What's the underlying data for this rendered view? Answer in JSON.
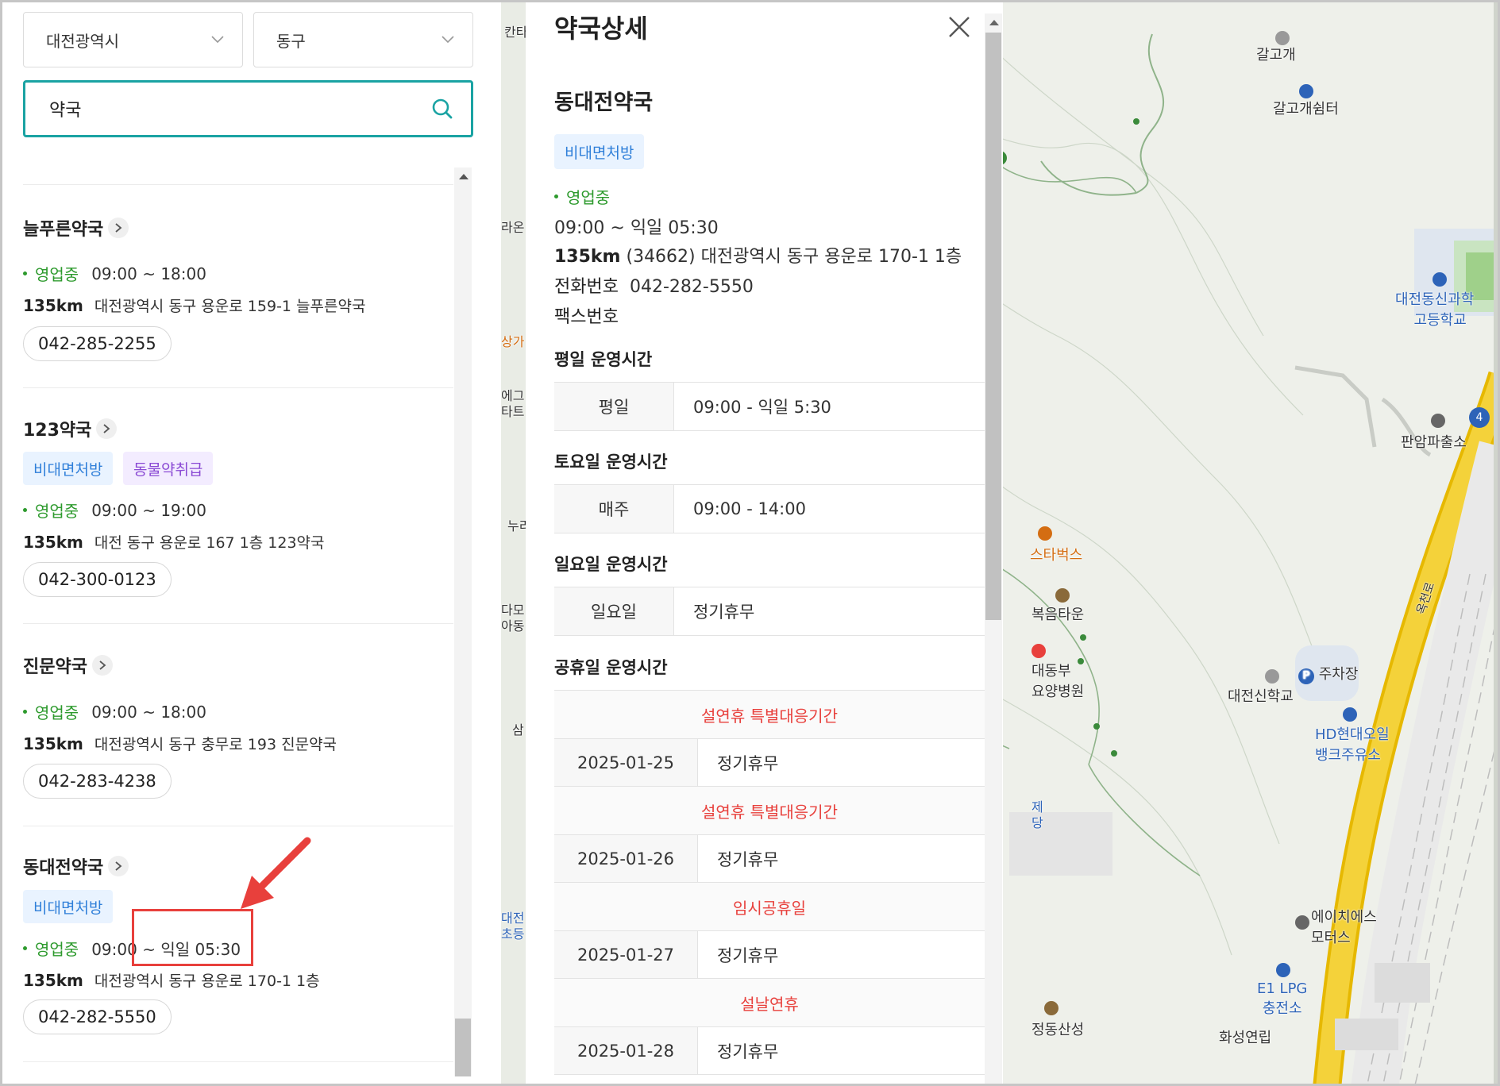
{
  "filters": {
    "city": "대전광역시",
    "district": "동구",
    "search_value": "약국"
  },
  "pharmacies": [
    {
      "name": "늘푸른약국",
      "tags": [],
      "status": "영업중",
      "hours": "09:00 ~ 18:00",
      "distance": "135km",
      "address": "대전광역시 동구 용운로 159-1 늘푸른약국",
      "phone": "042-285-2255"
    },
    {
      "name": "123약국",
      "tags": [
        "비대면처방",
        "동물약취급"
      ],
      "status": "영업중",
      "hours": "09:00 ~ 19:00",
      "distance": "135km",
      "address": "대전 동구 용운로 167 1층 123약국",
      "phone": "042-300-0123"
    },
    {
      "name": "진문약국",
      "tags": [],
      "status": "영업중",
      "hours": "09:00 ~ 18:00",
      "distance": "135km",
      "address": "대전광역시 동구 충무로 193 진문약국",
      "phone": "042-283-4238"
    },
    {
      "name": "동대전약국",
      "tags": [
        "비대면처방"
      ],
      "status": "영업중",
      "hours": "09:00 ~ 익일 05:30",
      "distance": "135km",
      "address": "대전광역시 동구 용운로 170-1 1층",
      "phone": "042-282-5550"
    }
  ],
  "detail": {
    "title": "약국상세",
    "name": "동대전약국",
    "tag": "비대면처방",
    "status": "영업중",
    "hours": "09:00 ~ 익일 05:30",
    "distance": "135km",
    "postal_address": "(34662) 대전광역시 동구 용운로 170-1 1층",
    "phone_label": "전화번호",
    "phone": "042-282-5550",
    "fax_label": "팩스번호",
    "weekday_title": "평일 운영시간",
    "weekday": {
      "key": "평일",
      "value": "09:00 - 익일 5:30"
    },
    "saturday_title": "토요일 운영시간",
    "saturday": {
      "key": "매주",
      "value": "09:00 - 14:00"
    },
    "sunday_title": "일요일 운영시간",
    "sunday": {
      "key": "일요일",
      "value": "정기휴무"
    },
    "holiday_title": "공휴일 운영시간",
    "holidays": [
      {
        "label": "설연휴 특별대응기간",
        "date": "2025-01-25",
        "value": "정기휴무"
      },
      {
        "label": "설연휴 특별대응기간",
        "date": "2025-01-26",
        "value": "정기휴무"
      },
      {
        "label": "임시공휴일",
        "date": "2025-01-27",
        "value": "정기휴무"
      },
      {
        "label": "설날연휴",
        "date": "2025-01-28",
        "value": "정기휴무"
      }
    ]
  },
  "map_labels": {
    "galgogae": "갈고개",
    "galgogae_shelter": "갈고개쉼터",
    "school1_line1": "대전동신과학",
    "school1_line2": "고등학교",
    "police": "판암파출소",
    "route_badge": "4",
    "starbucks": "스타벅스",
    "town": "복음타운",
    "hospital_line1": "대동부",
    "hospital_line2": "요양병원",
    "parking": "주차장",
    "school2": "대전신학교",
    "gas_line1": "HD현대오일",
    "gas_line2": "뱅크주유소",
    "motors_line1": "에이치에스",
    "motors_line2": "모터스",
    "lpg_line1": "E1 LPG",
    "lpg_line2": "충전소",
    "sanseong": "정동산성",
    "villa": "화성연립",
    "road": "옥천로",
    "left_edge": [
      "칸타",
      "라온",
      "상가",
      "에그",
      "타트",
      "누리",
      "다모",
      "아동",
      "삼",
      "대전",
      "초등",
      "제",
      "당"
    ]
  }
}
